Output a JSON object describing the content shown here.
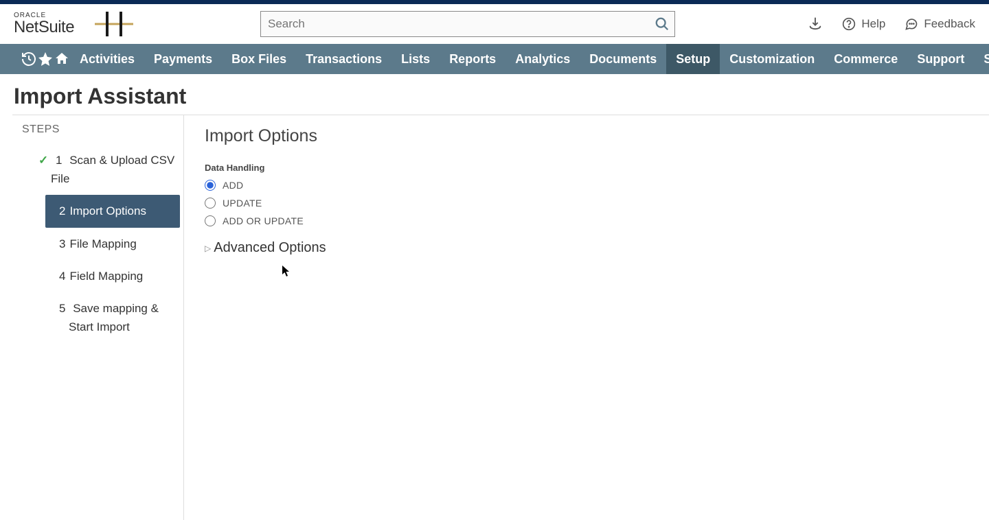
{
  "header": {
    "logo_top": "ORACLE",
    "logo_bottom": "NetSuite",
    "search_placeholder": "Search",
    "help_label": "Help",
    "feedback_label": "Feedback"
  },
  "nav": {
    "items": [
      {
        "label": "Activities",
        "active": false
      },
      {
        "label": "Payments",
        "active": false
      },
      {
        "label": "Box Files",
        "active": false
      },
      {
        "label": "Transactions",
        "active": false
      },
      {
        "label": "Lists",
        "active": false
      },
      {
        "label": "Reports",
        "active": false
      },
      {
        "label": "Analytics",
        "active": false
      },
      {
        "label": "Documents",
        "active": false
      },
      {
        "label": "Setup",
        "active": true
      },
      {
        "label": "Customization",
        "active": false
      },
      {
        "label": "Commerce",
        "active": false
      },
      {
        "label": "Support",
        "active": false
      },
      {
        "label": "SuiteSoc",
        "active": false
      }
    ]
  },
  "page": {
    "title": "Import Assistant"
  },
  "steps": {
    "header": "STEPS",
    "items": [
      {
        "num": "1",
        "label": "Scan & Upload CSV File",
        "completed": true,
        "active": false
      },
      {
        "num": "2",
        "label": "Import Options",
        "completed": false,
        "active": true
      },
      {
        "num": "3",
        "label": "File Mapping",
        "completed": false,
        "active": false
      },
      {
        "num": "4",
        "label": "Field Mapping",
        "completed": false,
        "active": false
      },
      {
        "num": "5",
        "label": "Save mapping & Start Import",
        "completed": false,
        "active": false
      }
    ]
  },
  "main": {
    "section_title": "Import Options",
    "data_handling_label": "Data Handling",
    "radios": [
      {
        "label": "ADD",
        "checked": true
      },
      {
        "label": "UPDATE",
        "checked": false
      },
      {
        "label": "ADD OR UPDATE",
        "checked": false
      }
    ],
    "advanced_label": "Advanced Options"
  }
}
